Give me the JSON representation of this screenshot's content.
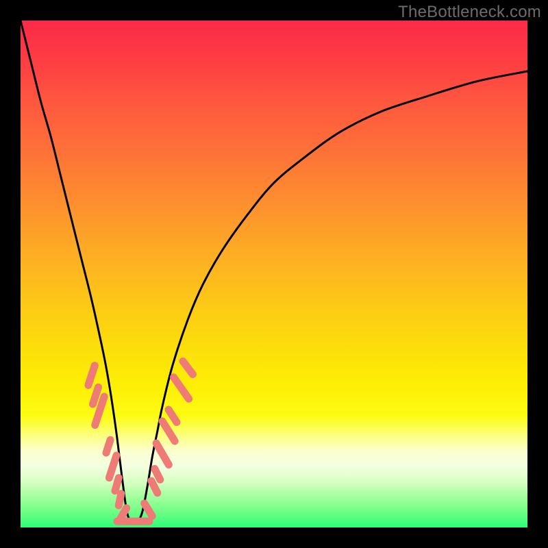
{
  "watermark": "TheBottleneck.com",
  "colors": {
    "frame": "#000000",
    "curve": "#000000",
    "marker_fill": "#ee7b76",
    "gradient_stops": [
      {
        "pct": 0,
        "hex": "#fc2a47"
      },
      {
        "pct": 8,
        "hex": "#fd3d43"
      },
      {
        "pct": 16,
        "hex": "#fe573f"
      },
      {
        "pct": 26,
        "hex": "#fd7237"
      },
      {
        "pct": 36,
        "hex": "#fd8f2f"
      },
      {
        "pct": 46,
        "hex": "#fdad24"
      },
      {
        "pct": 55,
        "hex": "#fdc618"
      },
      {
        "pct": 64,
        "hex": "#fcdd0b"
      },
      {
        "pct": 72,
        "hex": "#fdef05"
      },
      {
        "pct": 78,
        "hex": "#fdfb12"
      },
      {
        "pct": 82,
        "hex": "#fdff82"
      },
      {
        "pct": 85,
        "hex": "#fbffd0"
      },
      {
        "pct": 88,
        "hex": "#f4ffe1"
      },
      {
        "pct": 91,
        "hex": "#d6ffc3"
      },
      {
        "pct": 94,
        "hex": "#a2ff9d"
      },
      {
        "pct": 97,
        "hex": "#6dfe85"
      },
      {
        "pct": 100,
        "hex": "#2dfd76"
      }
    ]
  },
  "chart_data": {
    "type": "line",
    "title": "",
    "xlabel": "",
    "ylabel": "",
    "xlim": [
      0,
      100
    ],
    "ylim": [
      0,
      100
    ],
    "note": "Single V-shaped curve. x is a nominal 0–100 horizontal axis, y is height (0=bottom green, 100=top red). Minimum of curve ≈ x=21, y≈1. Marker points are the salmon data beads along the curve near the trough.",
    "series": [
      {
        "name": "bottleneck-curve",
        "x": [
          0,
          2,
          4,
          6,
          8,
          10,
          12,
          14,
          16,
          17,
          18,
          19,
          20,
          21,
          22,
          23,
          24,
          25,
          26,
          27,
          28,
          30,
          33,
          36,
          40,
          45,
          50,
          56,
          63,
          71,
          80,
          90,
          100
        ],
        "y": [
          100,
          92,
          84,
          77,
          69,
          61,
          53,
          45,
          36,
          31,
          25,
          18,
          10,
          3,
          1,
          1,
          3,
          8,
          14,
          19,
          24,
          32,
          41,
          48,
          55,
          62,
          68,
          73,
          78,
          82,
          85,
          88,
          90
        ]
      }
    ],
    "markers": [
      {
        "x": 14.0,
        "y": 30.0,
        "len": 3.2,
        "angle": -72
      },
      {
        "x": 14.8,
        "y": 26.0,
        "len": 2.8,
        "angle": -72
      },
      {
        "x": 15.6,
        "y": 23.0,
        "len": 4.5,
        "angle": -72
      },
      {
        "x": 17.3,
        "y": 16.0,
        "len": 2.2,
        "angle": -72
      },
      {
        "x": 18.2,
        "y": 12.0,
        "len": 3.6,
        "angle": -72
      },
      {
        "x": 19.0,
        "y": 8.5,
        "len": 2.2,
        "angle": -74
      },
      {
        "x": 19.6,
        "y": 5.5,
        "len": 2.0,
        "angle": -78
      },
      {
        "x": 20.3,
        "y": 2.8,
        "len": 2.0,
        "angle": -60
      },
      {
        "x": 21.5,
        "y": 1.2,
        "len": 3.8,
        "angle": 0
      },
      {
        "x": 23.5,
        "y": 1.2,
        "len": 3.0,
        "angle": 0
      },
      {
        "x": 25.2,
        "y": 3.5,
        "len": 2.4,
        "angle": 58
      },
      {
        "x": 26.4,
        "y": 8.0,
        "len": 2.2,
        "angle": 63
      },
      {
        "x": 27.0,
        "y": 10.5,
        "len": 2.0,
        "angle": 63
      },
      {
        "x": 28.0,
        "y": 14.5,
        "len": 3.8,
        "angle": 60
      },
      {
        "x": 29.2,
        "y": 19.0,
        "len": 3.6,
        "angle": 58
      },
      {
        "x": 30.0,
        "y": 22.0,
        "len": 2.4,
        "angle": 57
      },
      {
        "x": 31.7,
        "y": 27.5,
        "len": 4.0,
        "angle": 55
      },
      {
        "x": 33.0,
        "y": 31.5,
        "len": 2.6,
        "angle": 53
      }
    ]
  }
}
